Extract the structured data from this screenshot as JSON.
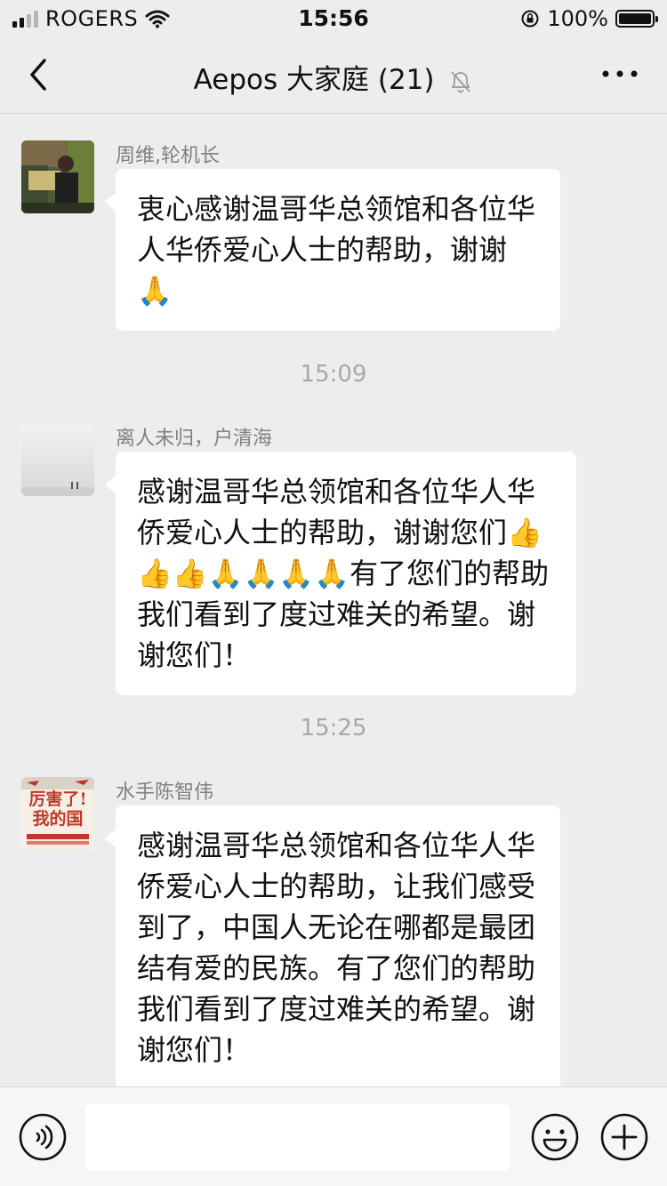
{
  "status_bar": {
    "carrier": "ROGERS",
    "time": "15:56",
    "battery": "100%"
  },
  "nav": {
    "title": "Aepos 大家庭 (21)"
  },
  "messages": [
    {
      "sender": "周维,轮机长",
      "text": "衷心感谢温哥华总领馆和各位华人华侨爱心人士的帮助，谢谢🙏"
    },
    {
      "sender": "离人未归，户清海",
      "text": "感谢温哥华总领馆和各位华人华侨爱心人士的帮助，谢谢您们👍👍👍🙏🙏🙏🙏有了您们的帮助我们看到了度过难关的希望。谢谢您们！"
    },
    {
      "sender": "水手陈智伟",
      "text": "感谢温哥华总领馆和各位华人华侨爱心人士的帮助，让我们感受到了，中国人无论在哪都是最团结有爱的民族。有了您们的帮助我们看到了度过难关的希望。谢谢您们！"
    }
  ],
  "timestamps": [
    "15:09",
    "15:25"
  ],
  "avatars": {
    "third_avatar_text": "厉害了!我的国"
  },
  "input": {
    "value": ""
  },
  "icons": {
    "back": "chevron-left-icon",
    "mute": "bell-slash-icon",
    "more": "more-dots-icon",
    "voice": "voice-icon",
    "emoji": "emoji-icon",
    "plus": "plus-icon"
  },
  "colors": {
    "background": "#ededed",
    "bubble": "#ffffff",
    "meta_text": "#808080"
  }
}
